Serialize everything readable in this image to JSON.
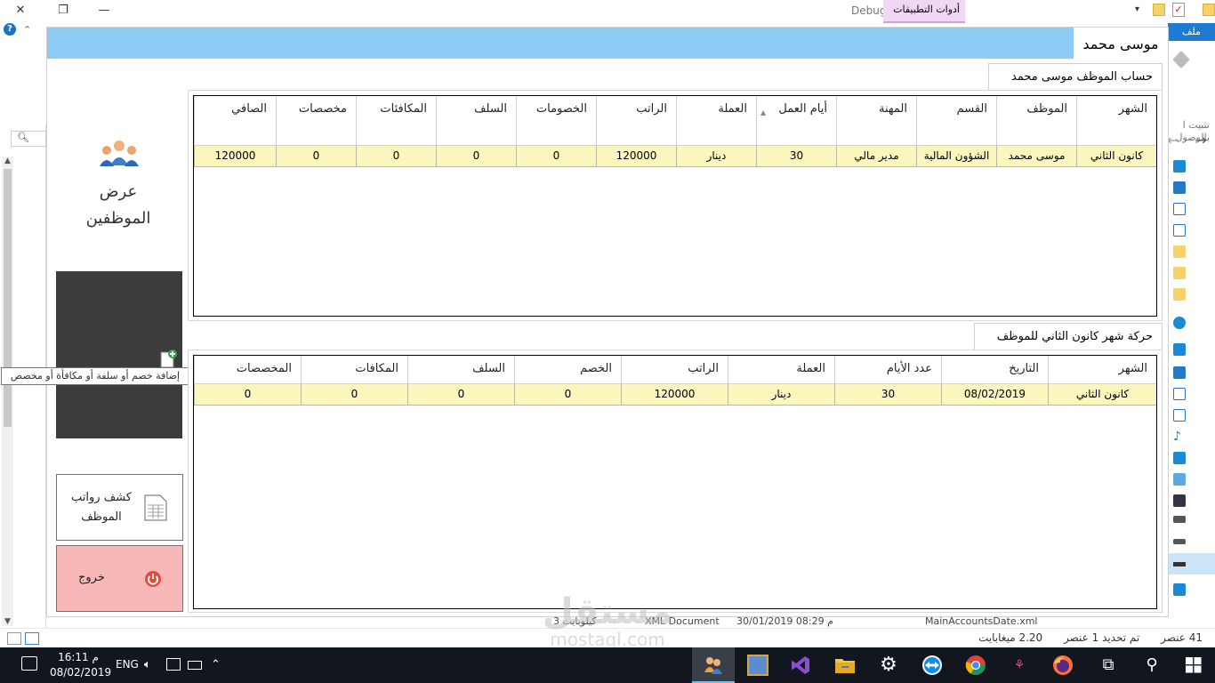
{
  "explorer": {
    "debug_label": "Debug",
    "app_tools_tab": "أدوات التطبيقات",
    "file_tab": "ملف",
    "pin_label": "تثبيت ا بالوصول",
    "status": {
      "items_count": "41 عنصر",
      "selected": "تم تحديد 1 عنصر",
      "size": "2.20 ميغابايت",
      "file_name": "MainAccountsDate.xml",
      "file_date": "30/01/2019 08:29 م",
      "file_type": "XML Document",
      "file_size": "3 كيلوبايت"
    }
  },
  "app": {
    "window_title": "موسى محمد",
    "sidebar": {
      "view_employees": "عرض الموظفين",
      "tooltip": "إضافة خصم أو سلفة أو مكافأة أو مخصص",
      "salary_report": "كشف رواتب الموظف",
      "exit": "خروج"
    },
    "account_group": {
      "title": "حساب الموظف موسى محمد",
      "headers": [
        "الشهر",
        "الموظف",
        "القسم",
        "المهنة",
        "أيام العمل",
        "العملة",
        "الراتب",
        "الخصومات",
        "السلف",
        "المكافئات",
        "مخصصات",
        "الصافي"
      ],
      "rows": [
        [
          "كانون الثاني",
          "موسى محمد",
          "الشؤون المالية",
          "مدير مالي",
          "30",
          "دينار",
          "120000",
          "0",
          "0",
          "0",
          "0",
          "120000"
        ]
      ]
    },
    "movement_group": {
      "title": "حركة شهر  كانون الثاني للموظف",
      "headers": [
        "الشهر",
        "التاريخ",
        "عدد الأيام",
        "العملة",
        "الراتب",
        "الخصم",
        "السلف",
        "المكافات",
        "المخصصات"
      ],
      "rows": [
        [
          "كانون الثاني",
          "08/02/2019",
          "30",
          "دينار",
          "120000",
          "0",
          "0",
          "0",
          "0"
        ]
      ]
    }
  },
  "taskbar": {
    "time": "16:11 م",
    "date": "08/02/2019",
    "language": "ENG"
  },
  "watermark": {
    "brand_ar": "مستقل",
    "brand_en": "mostaql.com"
  },
  "colors": {
    "header_blue": "#8fccf5",
    "row_yellow": "#fbf6bd",
    "exit_pink": "#f8b8b8",
    "taskbar": "#11161f"
  }
}
